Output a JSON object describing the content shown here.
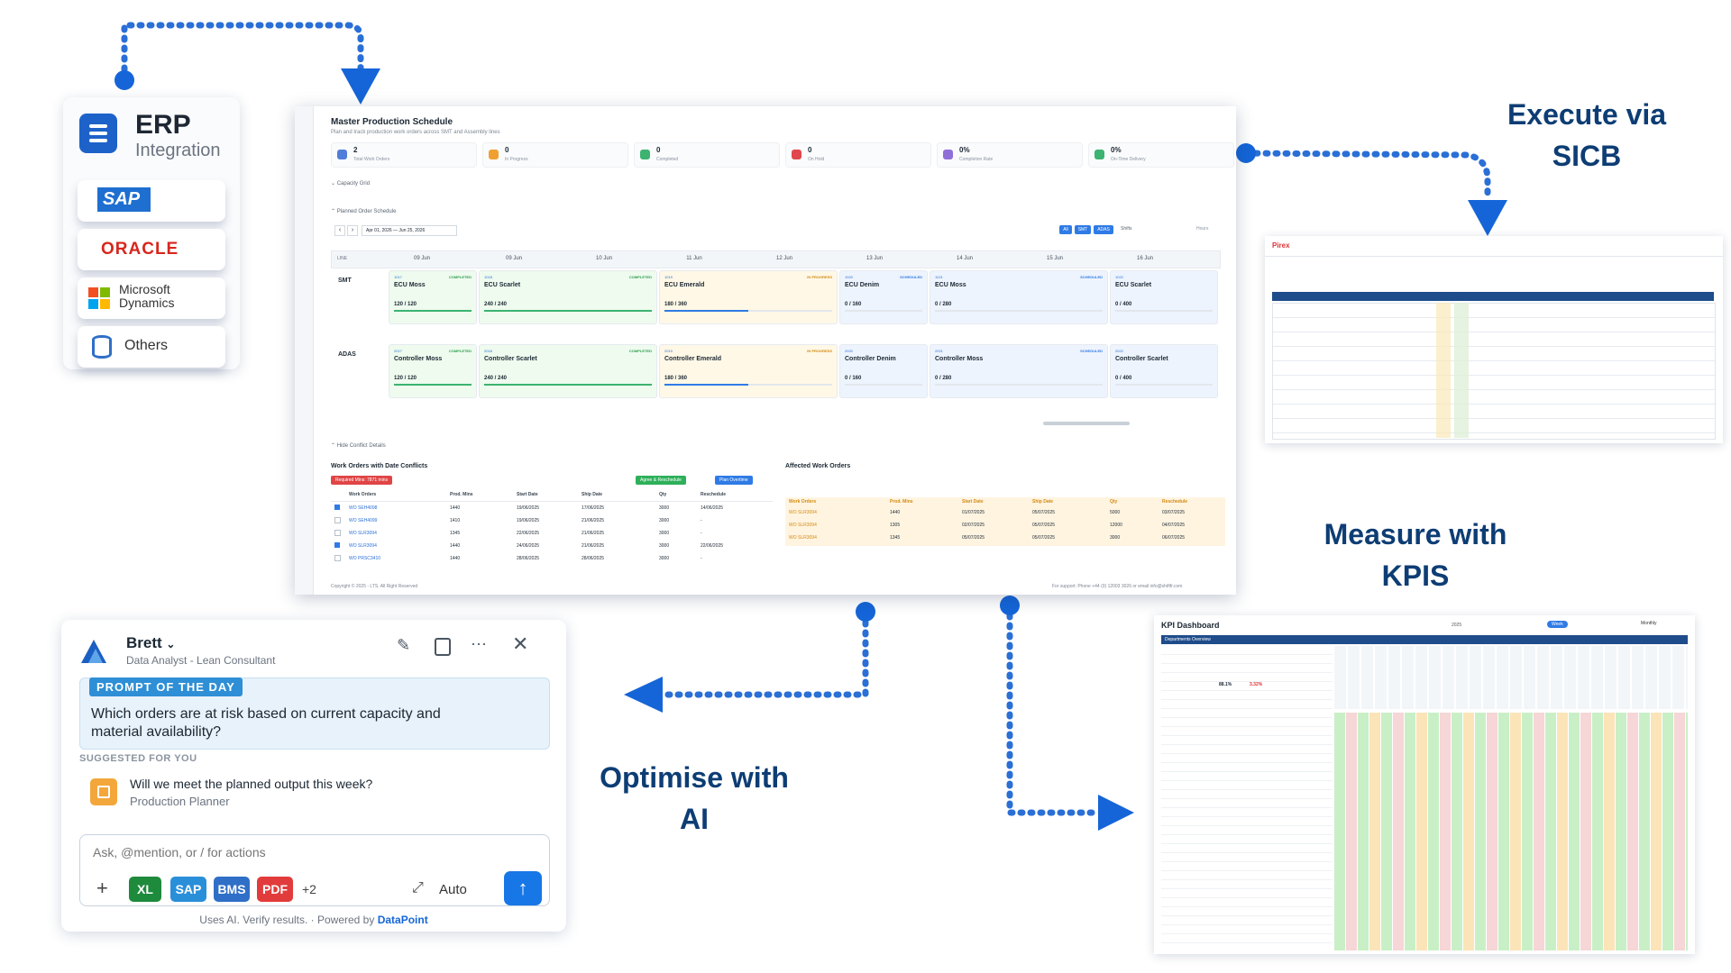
{
  "erp": {
    "title": "ERP",
    "subtitle": "Integration",
    "vendors": [
      "SAP",
      "ORACLE",
      "Microsoft Dynamics",
      "Others"
    ],
    "icon": "list-icon"
  },
  "labels": {
    "execute": [
      "Execute via",
      "SICB"
    ],
    "measure": [
      "Measure with",
      "KPIS"
    ],
    "optimise": [
      "Optimise with",
      "AI"
    ]
  },
  "mps": {
    "title": "Master Production Schedule",
    "subtitle": "Plan and track production work orders across SMT and Assembly lines",
    "kpis": [
      {
        "value": "2",
        "label": "Total Work Orders",
        "color": "#4f7dd9"
      },
      {
        "value": "0",
        "label": "In Progress",
        "color": "#f0a030"
      },
      {
        "value": "0",
        "label": "Completed",
        "color": "#3cb371"
      },
      {
        "value": "0",
        "label": "On Hold",
        "color": "#e0474c"
      },
      {
        "value": "0%",
        "label": "Completion Rate",
        "color": "#8e6fd8"
      },
      {
        "value": "0%",
        "label": "On-Time Delivery",
        "color": "#3cb371"
      }
    ],
    "capacity_grid": "Capacity Grid",
    "planned_schedule": "Planned Order Schedule",
    "date_range": "Apr 01, 2026 — Jun 25, 2026",
    "line_header": "LINE",
    "days": [
      "09 Jun",
      "09 Jun",
      "10 Jun",
      "11 Jun",
      "12 Jun",
      "13 Jun",
      "14 Jun",
      "15 Jun",
      "16 Jun"
    ],
    "lines": [
      "SMT",
      "ADAS"
    ],
    "filter_buttons": [
      "All",
      "SMT",
      "ADAS"
    ],
    "shifts_label": "Shifts",
    "hours_label": "Hours",
    "smt_cards": [
      {
        "num": "1017",
        "status": "COMPLETED",
        "title": "ECU Moss",
        "qty": "120 / 120"
      },
      {
        "num": "1018",
        "status": "COMPLETED",
        "title": "ECU Scarlet",
        "qty": "240 / 240"
      },
      {
        "num": "1019",
        "status": "IN PROGRESS",
        "title": "ECU Emerald",
        "qty": "180 / 360"
      },
      {
        "num": "1020",
        "status": "SCHEDULED",
        "title": "ECU Denim",
        "qty": "0 / 160"
      },
      {
        "num": "1021",
        "status": "SCHEDULED",
        "title": "ECU Moss",
        "qty": "0 / 280"
      },
      {
        "num": "1022",
        "status": "SCHEDULED",
        "title": "ECU Scarlet",
        "qty": "0 / 400"
      }
    ],
    "adas_cards": [
      {
        "num": "2017",
        "status": "COMPLETED",
        "title": "Controller Moss",
        "qty": "120 / 120"
      },
      {
        "num": "2018",
        "status": "COMPLETED",
        "title": "Controller Scarlet",
        "qty": "240 / 240"
      },
      {
        "num": "2019",
        "status": "IN PROGRESS",
        "title": "Controller Emerald",
        "qty": "180 / 360"
      },
      {
        "num": "2020",
        "status": "SCHEDULED",
        "title": "Controller Denim",
        "qty": "0 / 160"
      },
      {
        "num": "2021",
        "status": "SCHEDULED",
        "title": "Controller Moss",
        "qty": "0 / 280"
      },
      {
        "num": "2022",
        "status": "SCHEDULED",
        "title": "Controller Scarlet",
        "qty": "0 / 400"
      }
    ],
    "hide_conflicts": "Hide Conflict Details",
    "conflicts_title": "Work Orders with Date Conflicts",
    "required_badge": "Required Mins: 7871 mins",
    "agree_btn": "Agree & Reschedule",
    "overtime_btn": "Plan Overtime",
    "conflict_headers": [
      "Work Orders",
      "Prod. Mins",
      "Start Date",
      "Ship Date",
      "Qty",
      "Reschedule"
    ],
    "conflict_rows": [
      [
        "WO SEH4098",
        "1440",
        "19/06/2025",
        "17/06/2025",
        "3000",
        "14/06/2025"
      ],
      [
        "WO SEH4099",
        "1410",
        "19/06/2025",
        "21/06/2025",
        "3000",
        "-"
      ],
      [
        "WO SLR3094",
        "1345",
        "22/06/2025",
        "21/06/2025",
        "3000",
        "-"
      ],
      [
        "WO SLR3094",
        "1440",
        "24/06/2025",
        "21/06/2025",
        "3000",
        "22/06/2025"
      ],
      [
        "WO PRSC3410",
        "1440",
        "28/06/2025",
        "28/06/2025",
        "3000",
        "-"
      ]
    ],
    "affected_title": "Affected Work Orders",
    "affected_headers": [
      "Work Orders",
      "Prod. Mins",
      "Start Date",
      "Ship Date",
      "Qty",
      "Reschedule"
    ],
    "affected_rows": [
      [
        "WO SLR3094",
        "1440",
        "01/07/2025",
        "05/07/2025",
        "5000",
        "03/07/2025"
      ],
      [
        "WO SLR3094",
        "1305",
        "02/07/2025",
        "05/07/2025",
        "12000",
        "04/07/2025"
      ],
      [
        "WO SLR3094",
        "1345",
        "05/07/2025",
        "05/07/2025",
        "3000",
        "06/07/2025"
      ]
    ],
    "footer_left": "Copyright © 2025 - LTS. All Right Reserved",
    "footer_right": "For support: Phone +44 (0) 12003 3026 or email info@shiftfr.com"
  },
  "chat": {
    "user_name": "Brett",
    "user_role": "Data Analyst - Lean Consultant",
    "potd_label": "PROMPT OF THE DAY",
    "potd_text": "Which orders are at risk based on current capacity and material availability?",
    "suggested_label": "SUGGESTED FOR YOU",
    "suggestion_text": "Will we meet the planned output this week?",
    "suggestion_role": "Production Planner",
    "input_placeholder": "Ask, @mention, or / for actions",
    "chips": [
      {
        "label": "XL",
        "color": "#1e8a3c"
      },
      {
        "label": "SAP",
        "color": "#2a8fd9"
      },
      {
        "label": "BMS",
        "color": "#2f6fc7"
      },
      {
        "label": "PDF",
        "color": "#e23b3b"
      }
    ],
    "more_count": "+2",
    "mode": "Auto",
    "footer_text": "Uses AI. Verify results. · Powered by ",
    "footer_brand": "DataPoint"
  },
  "sicb": {
    "brand": "Pirex"
  },
  "kpi_dashboard": {
    "title": "KPI Dashboard",
    "header_label": "Departments Overview",
    "period_buttons": [
      "Week",
      "Monthly"
    ],
    "year": "2025",
    "values": [
      "88.1%",
      "3.32%"
    ]
  }
}
